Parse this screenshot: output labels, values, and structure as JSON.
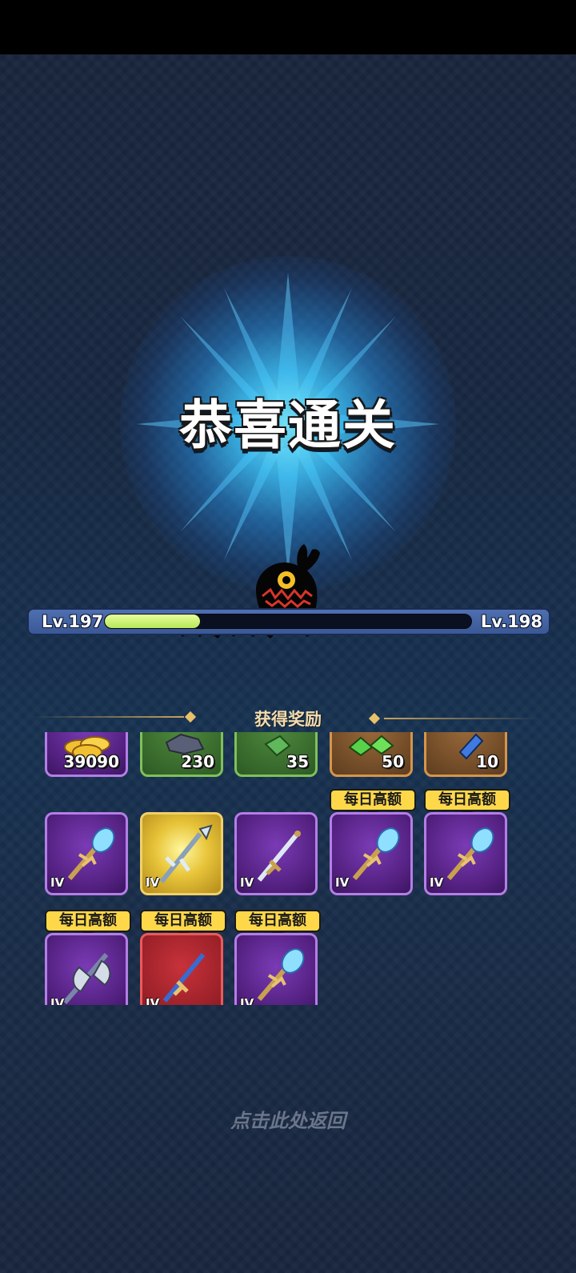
{
  "title": "恭喜通关",
  "level": {
    "current": "Lv.197",
    "next": "Lv.198",
    "progress": 0.26
  },
  "rewards": {
    "header": "获得奖励",
    "resources": [
      {
        "icon": "gold-coins-icon",
        "qty": "39090",
        "rarity": "purple"
      },
      {
        "icon": "iron-ore-icon",
        "qty": "230",
        "rarity": "green"
      },
      {
        "icon": "green-crystal-icon",
        "qty": "35",
        "rarity": "green"
      },
      {
        "icon": "green-gems-icon",
        "qty": "50",
        "rarity": "bronze"
      },
      {
        "icon": "blue-gem-icon",
        "qty": "10",
        "rarity": "bronze"
      }
    ],
    "row2": [
      {
        "icon": "crystal-staff-icon",
        "tier": "IV",
        "rarity": "purple"
      },
      {
        "icon": "gold-spear-icon",
        "tier": "IV",
        "rarity": "gold"
      },
      {
        "icon": "silver-sword-icon",
        "tier": "IV",
        "rarity": "purple"
      },
      {
        "icon": "crystal-staff-icon",
        "tier": "IV",
        "rarity": "purple",
        "badge": "每日高额"
      },
      {
        "icon": "crystal-staff-icon",
        "tier": "IV",
        "rarity": "purple",
        "badge": "每日高额"
      }
    ],
    "row3": [
      {
        "icon": "battle-axe-icon",
        "tier": "IV",
        "rarity": "purple",
        "badge": "每日高额"
      },
      {
        "icon": "blue-sword-icon",
        "tier": "IV",
        "rarity": "red",
        "badge": "每日高额"
      },
      {
        "icon": "crystal-staff-icon",
        "tier": "IV",
        "rarity": "purple",
        "badge": "每日高额"
      }
    ]
  },
  "back_label": "点击此处返回"
}
